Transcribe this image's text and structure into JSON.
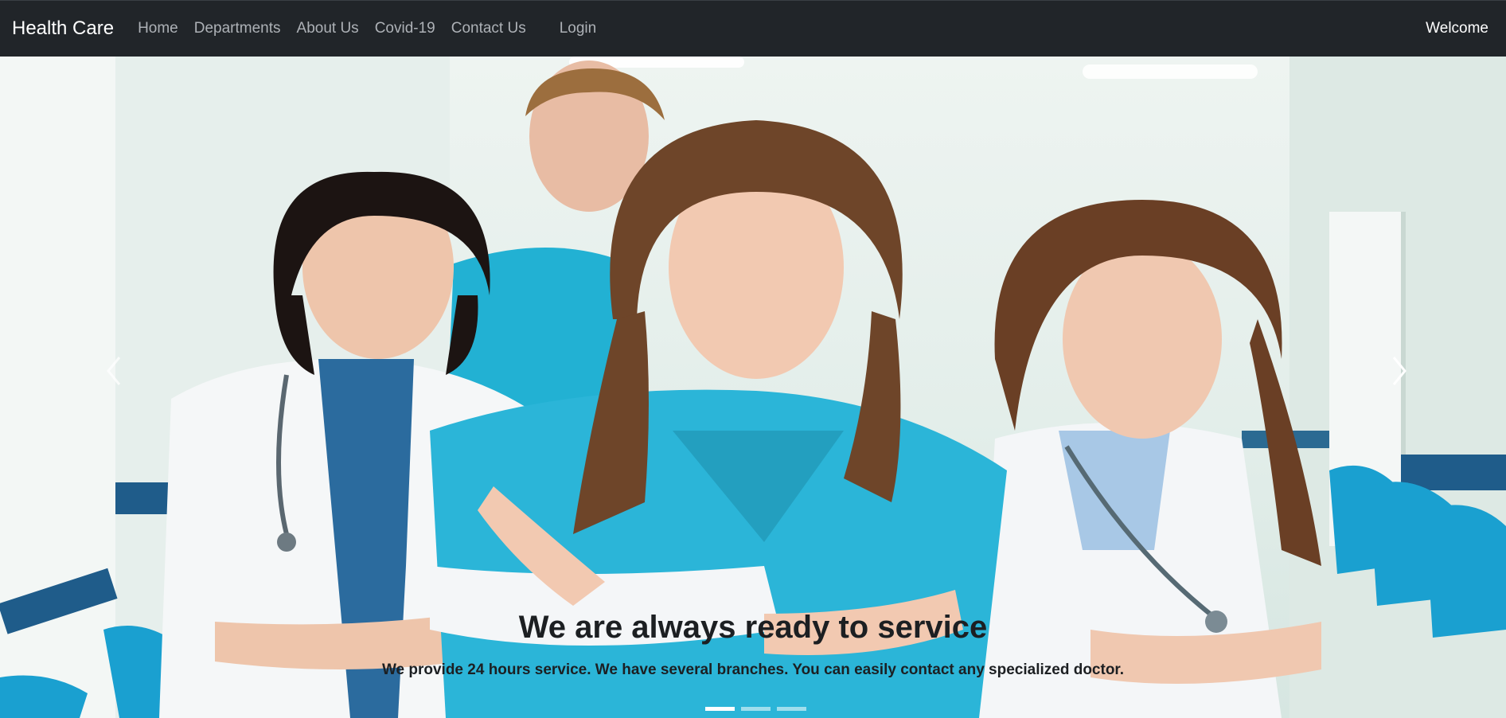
{
  "navbar": {
    "brand": "Health Care",
    "links": [
      "Home",
      "Departments",
      "About Us",
      "Covid-19",
      "Contact Us"
    ],
    "login": "Login",
    "welcome": "Welcome"
  },
  "carousel": {
    "heading": "We are always ready to service",
    "text": "We provide 24 hours service. We have several branches. You can easily contact any specialized doctor.",
    "active_slide": 1,
    "slide_count": 3,
    "prev_icon": "chevron-left-icon",
    "next_icon": "chevron-right-icon"
  },
  "colors": {
    "navbar_bg": "#212529",
    "scrubs": "#2bb5d8",
    "coat": "#f4f6f7"
  }
}
